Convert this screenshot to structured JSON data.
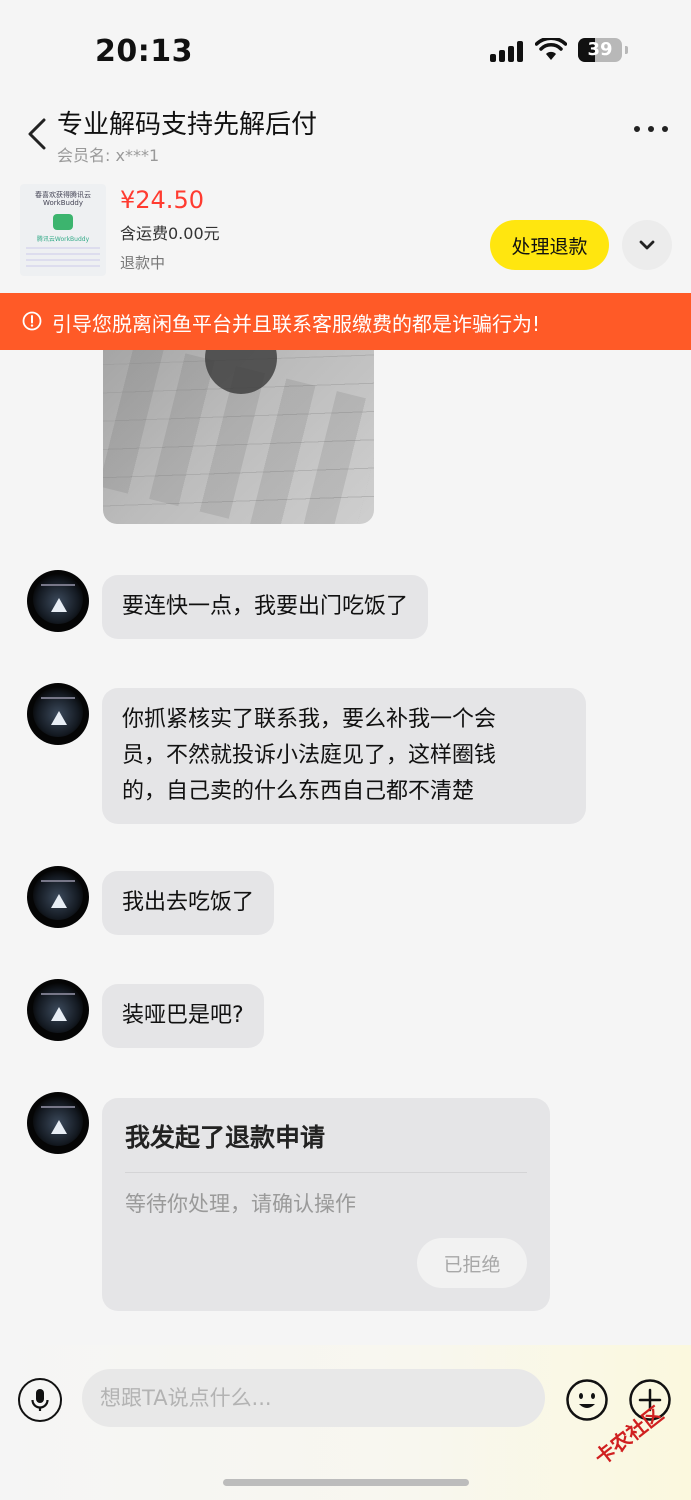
{
  "status_bar": {
    "time": "20:13",
    "battery": "39"
  },
  "header": {
    "title": "专业解码支持先解后付",
    "member_label": "会员名:",
    "member_name": "x***1"
  },
  "product": {
    "thumb_line1": "春喜欢获得腾讯云",
    "thumb_line2": "WorkBuddy",
    "thumb_line3": "腾讯云WorkBuddy",
    "price": "¥24.50",
    "shipping": "含运费0.00元",
    "status": "退款中",
    "action_label": "处理退款"
  },
  "warning": {
    "text": "引导您脱离闲鱼平台并且联系客服缴费的都是诈骗行为!"
  },
  "messages": [
    {
      "text": "要连快一点，我要出门吃饭了"
    },
    {
      "line1": "你抓紧核实了联系我，要么补我一个会",
      "line2": "员，不然就投诉小法庭见了，这样圈钱",
      "line3": "的，自己卖的什么东西自己都不清楚"
    },
    {
      "text": "我出去吃饭了"
    },
    {
      "text": "装哑巴是吧?"
    }
  ],
  "refund_card": {
    "title": "我发起了退款申请",
    "subtitle": "等待你处理，请确认操作",
    "button": "已拒绝"
  },
  "input": {
    "placeholder": "想跟TA说点什么..."
  },
  "watermark": "卡农社区"
}
